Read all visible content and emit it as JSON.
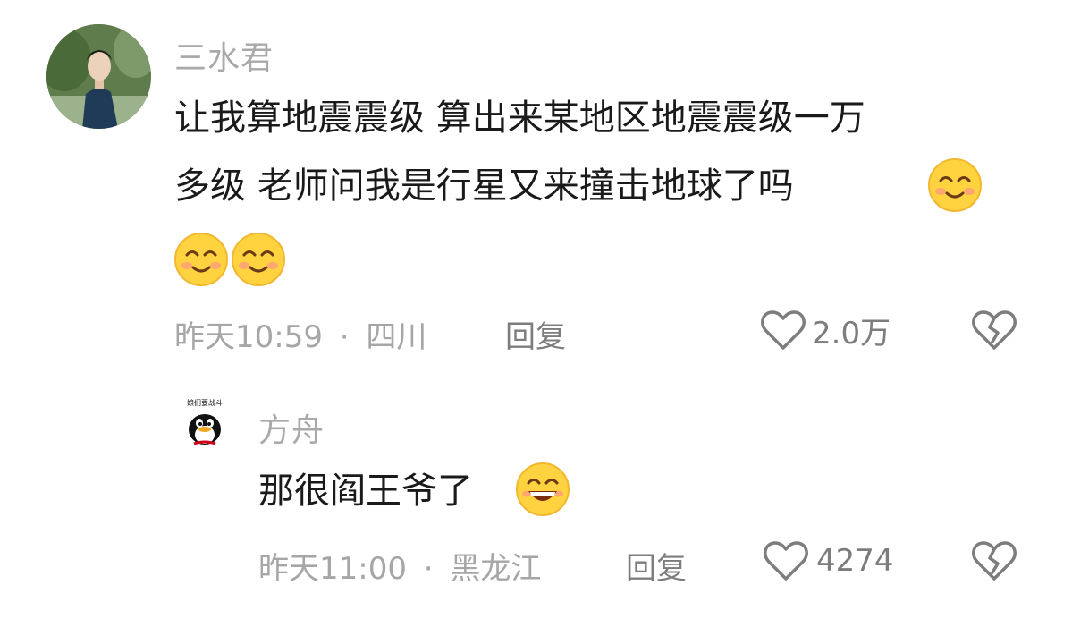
{
  "comments": [
    {
      "username": "三水君",
      "text_line1": "让我算地震震级  算出来某地区地震震级一万",
      "text_line2": "多级  老师问我是行星又来撞击地球了吗",
      "emoji_line2": [
        "smile-emoji"
      ],
      "emoji_line3": [
        "smile-emoji",
        "smile-emoji"
      ],
      "time": "昨天10:59",
      "separator": "·",
      "location": "四川",
      "reply_label": "回复",
      "like_count": "2.0万",
      "avatar_icon": "person-photo-avatar",
      "like_icon": "heart-icon",
      "dislike_icon": "broken-heart-icon"
    },
    {
      "username": "方舟",
      "text_line1": "那很阎王爷了",
      "emoji_line1": [
        "grin-emoji"
      ],
      "avatar_text": "娘们要战斗",
      "time": "昨天11:00",
      "separator": "·",
      "location": "黑龙江",
      "reply_label": "回复",
      "like_count": "4274",
      "avatar_icon": "penguin-avatar",
      "like_icon": "heart-icon",
      "dislike_icon": "broken-heart-icon"
    }
  ],
  "colors": {
    "username": "#a9a9a9",
    "text": "#1a1a1a",
    "meta": "#a6a6a6",
    "action": "#7d7d7d",
    "emoji_face": "#ffd23f"
  }
}
